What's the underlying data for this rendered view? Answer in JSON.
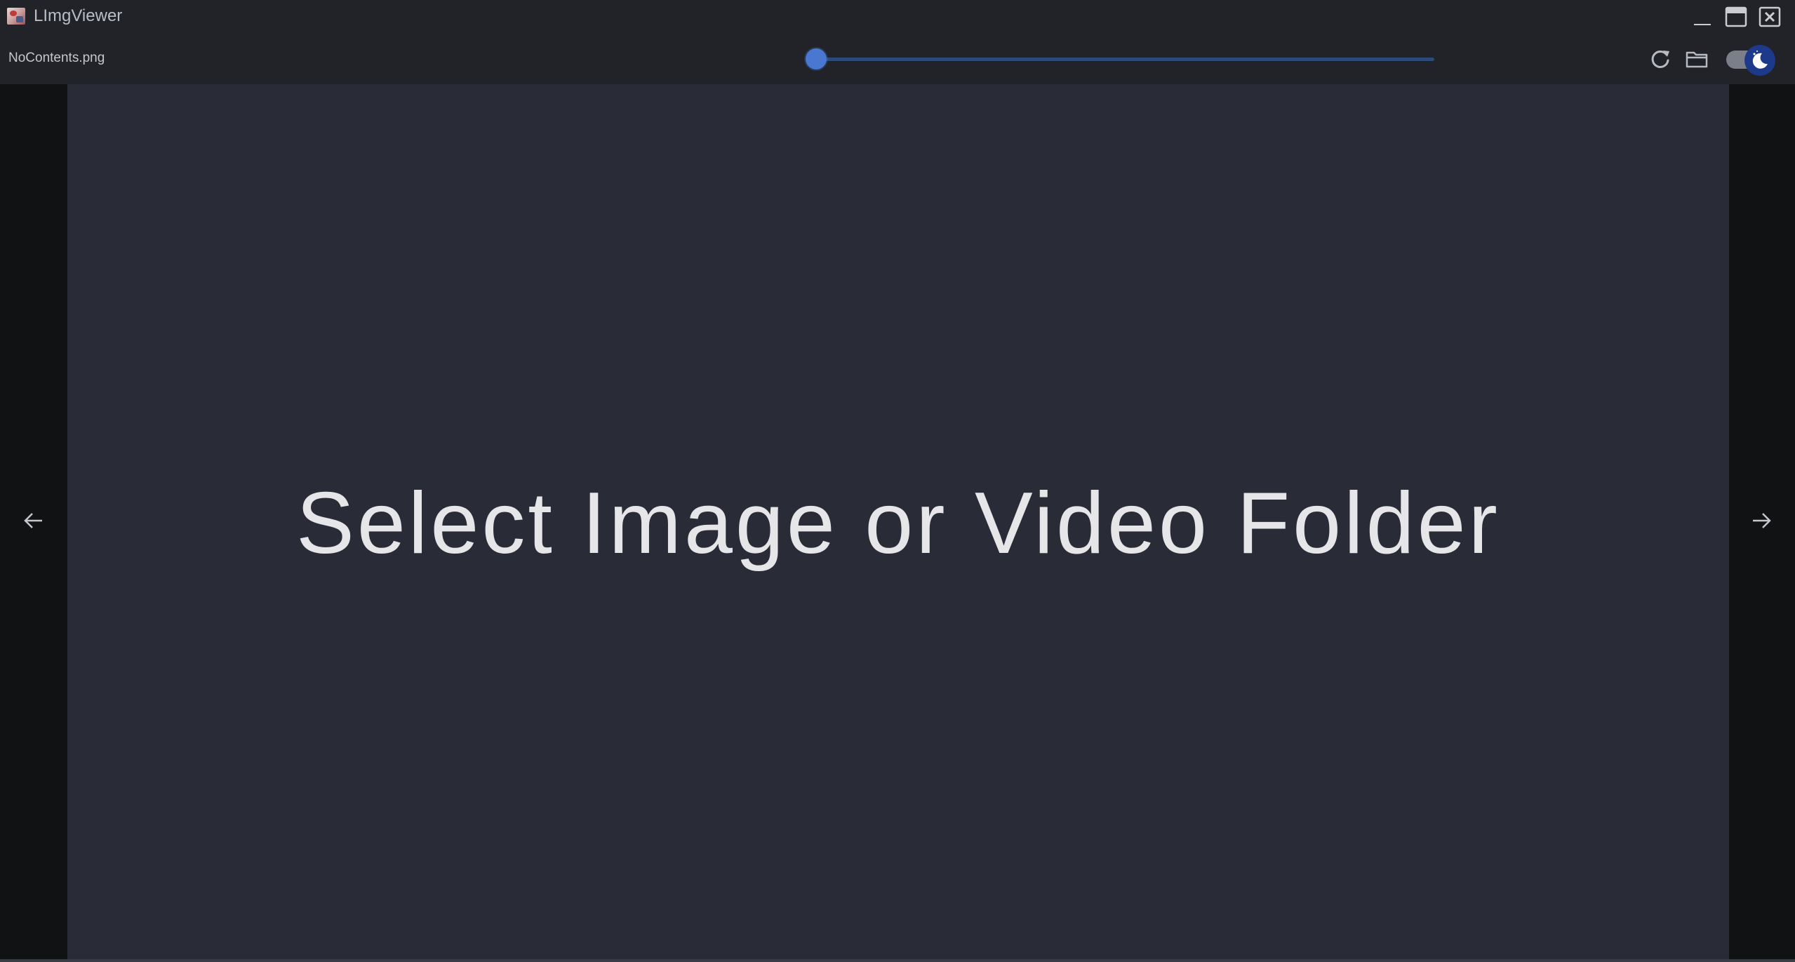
{
  "window": {
    "title": "LImgViewer",
    "icon": "app-icon",
    "controls": [
      "minimize-icon",
      "maximize-icon",
      "close-icon"
    ]
  },
  "toolbar": {
    "filename": "NoContents.png",
    "slider": {
      "value": 0,
      "min": 0,
      "max": 100,
      "accent": "#4a78d0",
      "track_color": "#2c4a7a"
    },
    "refresh_icon": "refresh-icon",
    "folder_icon": "folder-open-icon",
    "theme_toggle": {
      "state": "dark",
      "icon": "moon-icon",
      "accent": "#1d3a8a"
    }
  },
  "navigation": {
    "prev_icon": "arrow-left-icon",
    "next_icon": "arrow-right-icon"
  },
  "content": {
    "placeholder_text": "Select Image or Video Folder",
    "background": "#292c36",
    "text_color": "#e6e6e8"
  }
}
